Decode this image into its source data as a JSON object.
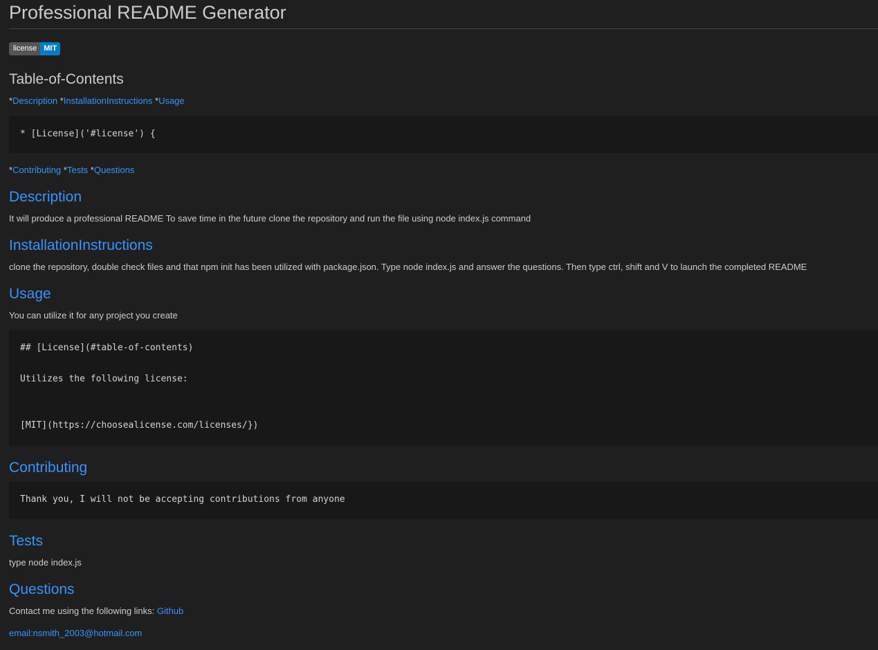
{
  "title": "Professional README Generator",
  "badge": {
    "label": "license",
    "value": "MIT"
  },
  "toc": {
    "heading": "Table-of-Contents",
    "line1": {
      "star1": "*",
      "link1": "Description",
      "star2": " *",
      "link2": "InstallationInstructions",
      "star3": " *",
      "link3": "Usage"
    },
    "code": "* [License]('#license') {",
    "line2": {
      "star1": "*",
      "link1": "Contributing",
      "star2": " *",
      "link2": "Tests",
      "star3": " *",
      "link3": "Questions"
    }
  },
  "description": {
    "heading": "Description",
    "text": "It will produce a professional README To save time in the future clone the repository and run the file using node index.js command"
  },
  "installation": {
    "heading": "InstallationInstructions",
    "text": "clone the repository, double check files and that npm init has been utilized with package.json. Type node index.js and answer the questions. Then type ctrl, shift and V to launch the completed README"
  },
  "usage": {
    "heading": "Usage",
    "text": "You can utilize it for any project you create",
    "code": {
      "line1": "## [License](#table-of-contents)",
      "line2": "Utilizes the following license:",
      "line3": "[MIT](https://choosealicense.com/licenses/})"
    }
  },
  "contributing": {
    "heading": "Contributing",
    "code": "Thank you, I will not be accepting contributions from anyone"
  },
  "tests": {
    "heading": "Tests",
    "text": "type node index.js"
  },
  "questions": {
    "heading": "Questions",
    "text": "Contact me using the following links: ",
    "github_link": "Github",
    "email_link": "email:nsmith_2003@hotmail.com"
  },
  "colors": {
    "background": "#1f1f1f",
    "link": "#3794ff",
    "code_bg": "#181818"
  }
}
